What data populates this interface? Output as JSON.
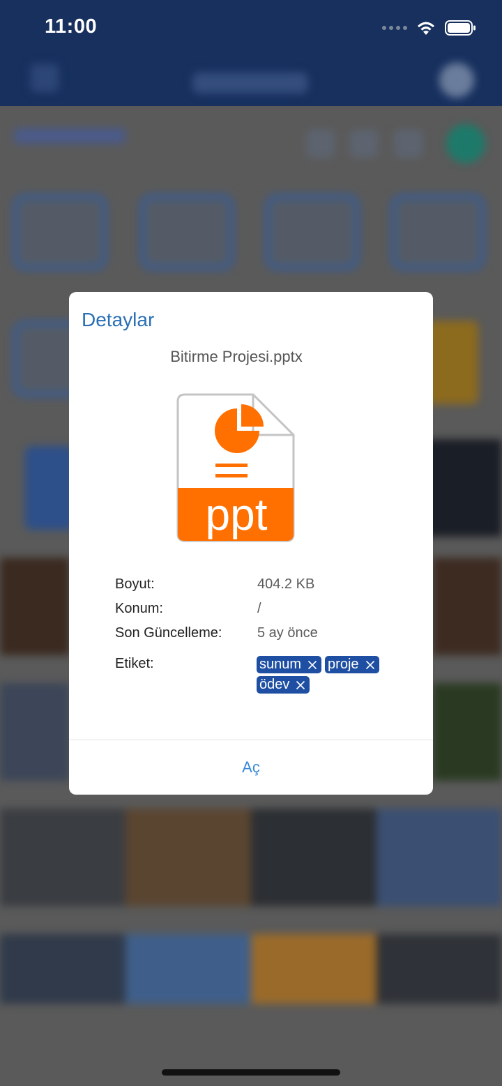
{
  "status_bar": {
    "time": "11:00",
    "icons": [
      "signal-icon",
      "wifi-icon",
      "battery-icon"
    ]
  },
  "dialog": {
    "title": "Detaylar",
    "file_name": "Bitirme Projesi.pptx",
    "file_icon": {
      "name": "ppt-file-icon",
      "label": "ppt",
      "accent_color": "#ff7000"
    },
    "details": [
      {
        "label": "Boyut:",
        "value": "404.2 KB"
      },
      {
        "label": "Konum:",
        "value": "/"
      },
      {
        "label": "Son Güncelleme:",
        "value": "5 ay önce"
      }
    ],
    "tags_label": "Etiket:",
    "tags": [
      "sunum",
      "proje",
      "ödev"
    ],
    "open_button": "Aç"
  },
  "colors": {
    "title_blue": "#2a6fb5",
    "tag_bg": "#1e4fa3",
    "link_blue": "#3a8ad6",
    "header_navy": "#17305e"
  }
}
